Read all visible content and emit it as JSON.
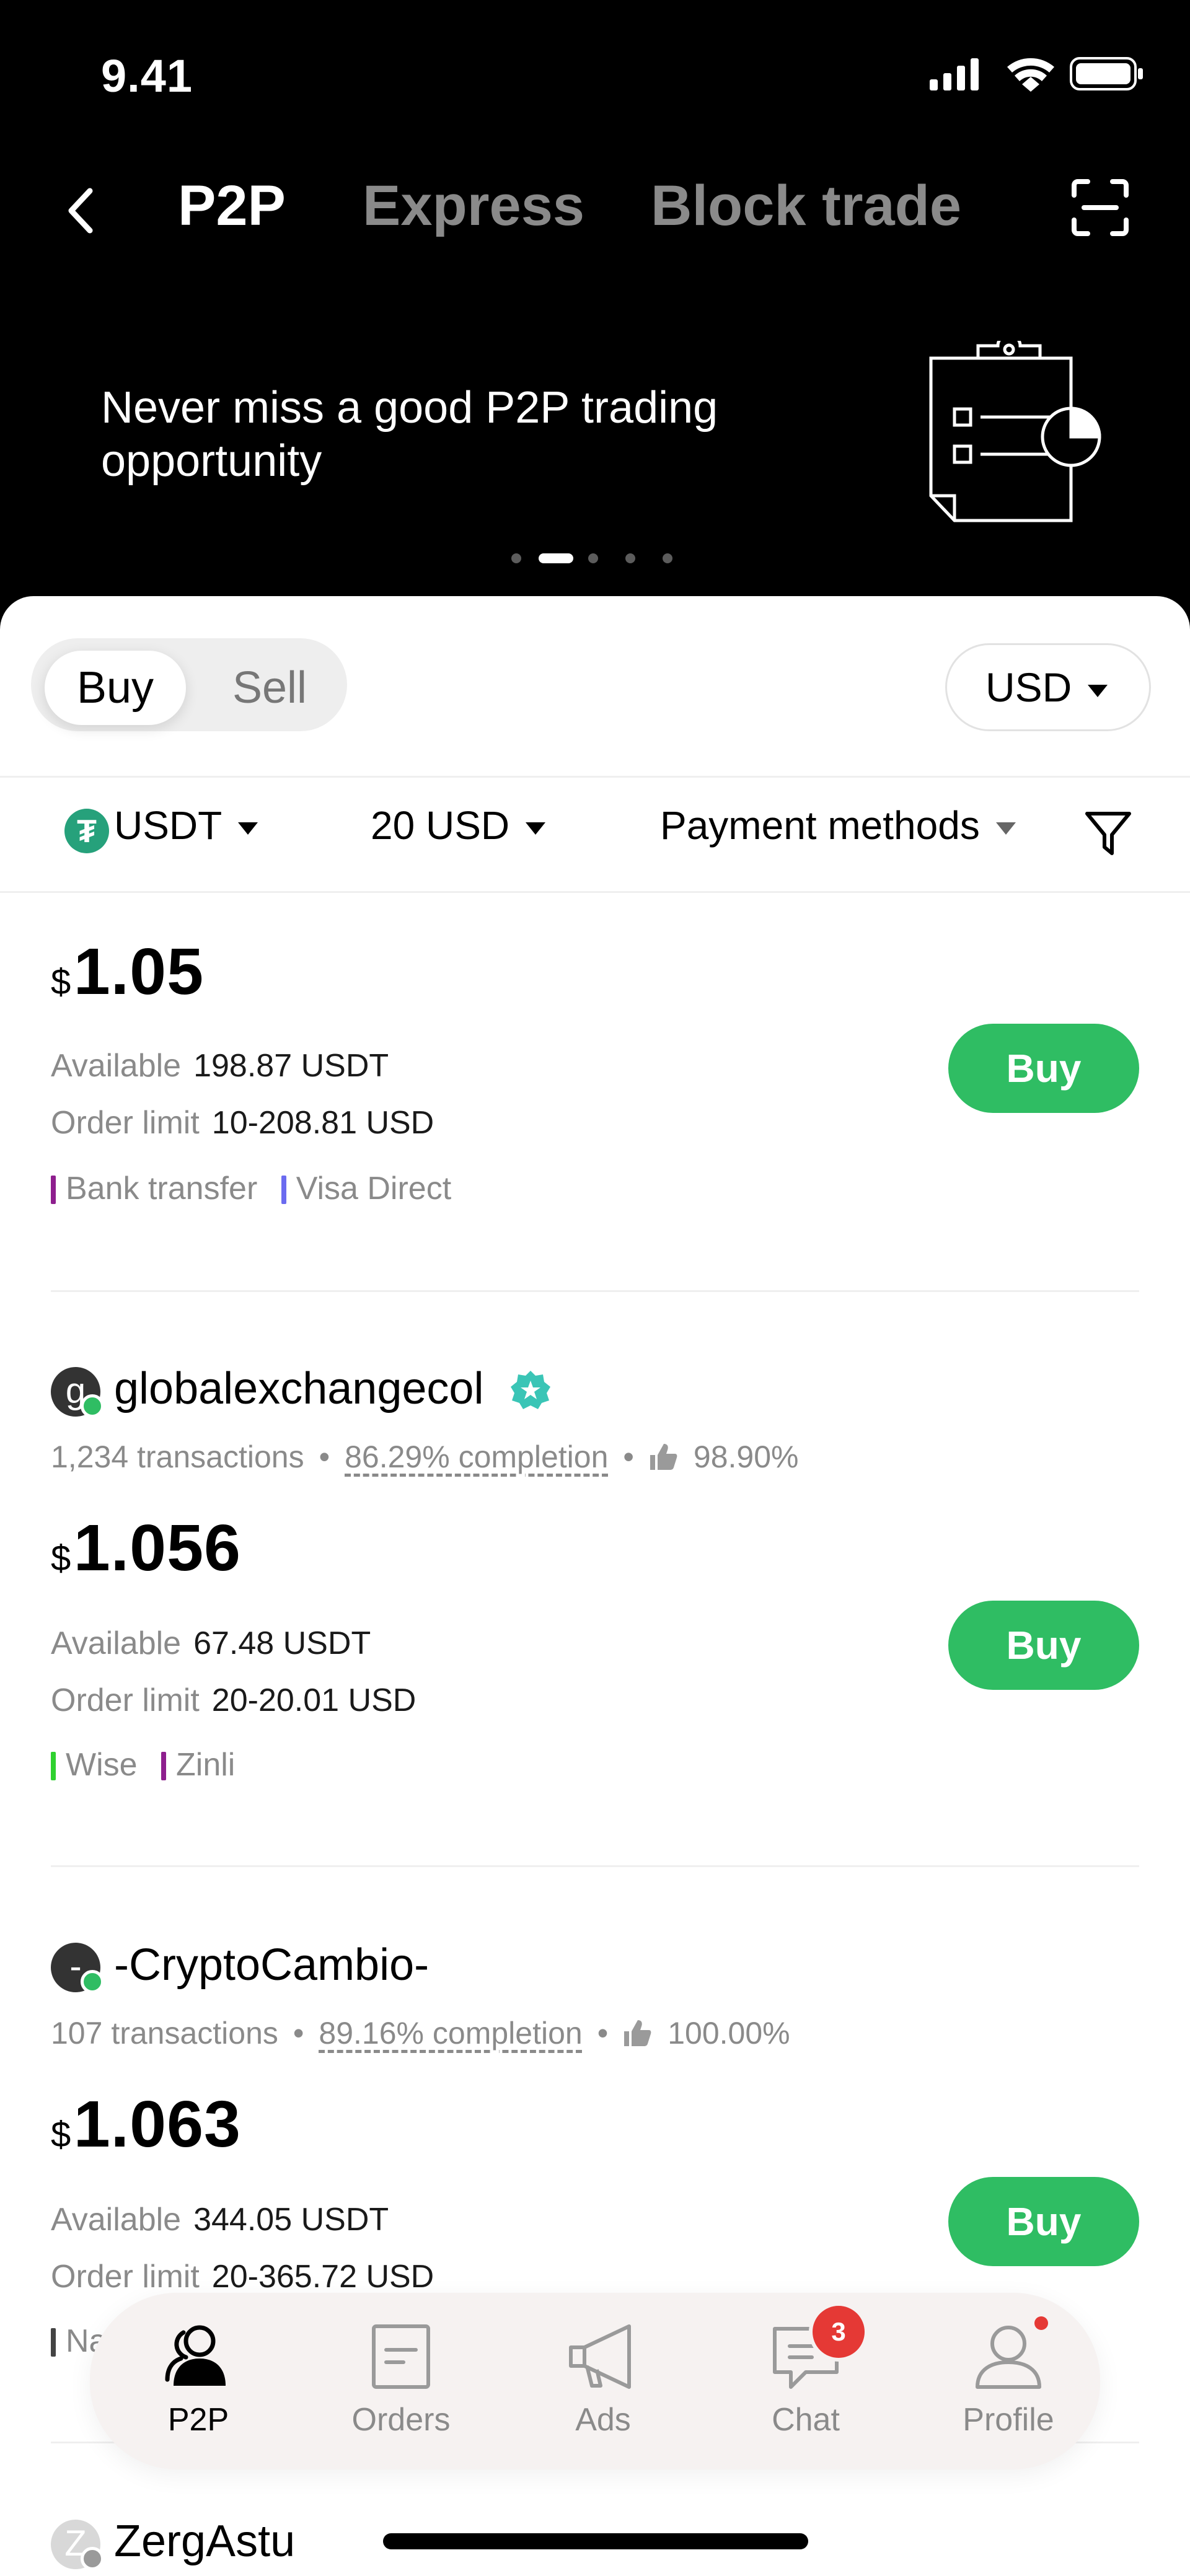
{
  "status_bar": {
    "time": "9.41"
  },
  "header": {
    "tabs": [
      {
        "label": "P2P",
        "active": true
      },
      {
        "label": "Express",
        "active": false
      },
      {
        "label": "Block trade",
        "active": false
      }
    ]
  },
  "banner": {
    "text": "Never miss a good P2P trading opportunity",
    "pages": 5,
    "active_page": 2
  },
  "segment": {
    "buy": "Buy",
    "sell": "Sell"
  },
  "currency": {
    "selected": "USD"
  },
  "filters": {
    "asset": "USDT",
    "amount": "20 USD",
    "payment": "Payment methods"
  },
  "offers": [
    {
      "currency_symbol": "$",
      "price": "1.05",
      "available_label": "Available",
      "available": "198.87 USDT",
      "limit_label": "Order limit",
      "limit": "10-208.81 USD",
      "payments": [
        {
          "name": "Bank transfer",
          "color": "#8e1f8e"
        },
        {
          "name": "Visa Direct",
          "color": "#6b6bf0"
        }
      ],
      "button": "Buy"
    },
    {
      "merchant": {
        "name": "globalexchangecol",
        "initial": "g",
        "verified": true
      },
      "transactions": "1,234 transactions",
      "completion": "86.29% completion",
      "rating": "98.90%",
      "currency_symbol": "$",
      "price": "1.056",
      "available_label": "Available",
      "available": "67.48 USDT",
      "limit_label": "Order limit",
      "limit": "20-20.01 USD",
      "payments": [
        {
          "name": "Wise",
          "color": "#2fd12f"
        },
        {
          "name": "Zinli",
          "color": "#8e1f8e"
        }
      ],
      "button": "Buy"
    },
    {
      "merchant": {
        "name": "-CryptoCambio-",
        "initial": "-"
      },
      "transactions": "107 transactions",
      "completion": "89.16% completion",
      "rating": "100.00%",
      "currency_symbol": "$",
      "price": "1.063",
      "available_label": "Available",
      "available": "344.05 USDT",
      "limit_label": "Order limit",
      "limit": "20-365.72 USD",
      "payments": [
        {
          "name": "Na",
          "color": "#444444"
        }
      ],
      "button": "Buy"
    },
    {
      "merchant": {
        "name": "ZergAstu",
        "initial": "Z"
      }
    }
  ],
  "bottom_nav": {
    "items": [
      {
        "label": "P2P",
        "icon": "users-icon",
        "active": true
      },
      {
        "label": "Orders",
        "icon": "document-icon"
      },
      {
        "label": "Ads",
        "icon": "megaphone-icon"
      },
      {
        "label": "Chat",
        "icon": "chat-icon",
        "badge": "3"
      },
      {
        "label": "Profile",
        "icon": "profile-icon",
        "dot": true
      }
    ]
  },
  "colors": {
    "accent_green": "#2fbd63",
    "badge_red": "#e53935",
    "usdt_green": "#26a17b"
  }
}
